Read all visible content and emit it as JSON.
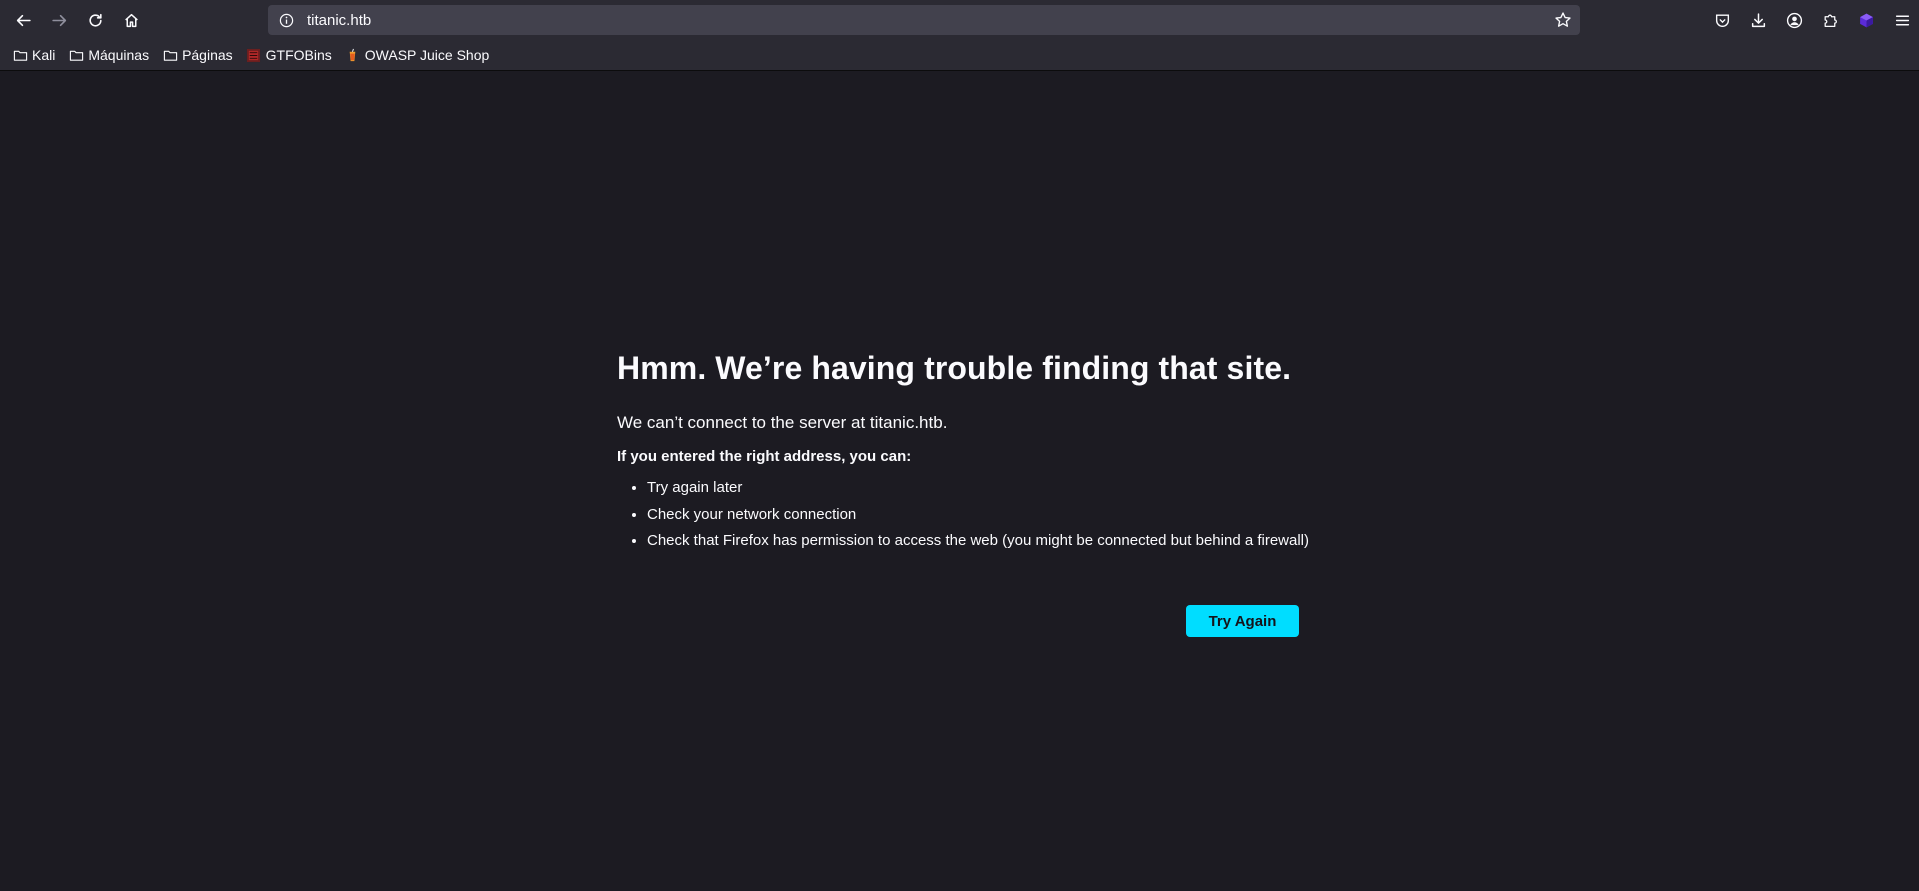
{
  "browser": {
    "url": "titanic.htb",
    "bookmarks": [
      {
        "label": "Kali",
        "icon": "folder-icon"
      },
      {
        "label": "Máquinas",
        "icon": "folder-icon"
      },
      {
        "label": "Páginas",
        "icon": "folder-icon"
      },
      {
        "label": "GTFOBins",
        "icon": "gtfobins-favicon"
      },
      {
        "label": "OWASP Juice Shop",
        "icon": "juice-shop-favicon"
      }
    ]
  },
  "error_page": {
    "title": "Hmm. We’re having trouble finding that site.",
    "description": "We can’t connect to the server at titanic.htb.",
    "hint_heading": "If you entered the right address, you can:",
    "suggestions": [
      "Try again later",
      "Check your network connection",
      "Check that Firefox has permission to access the web (you might be connected but behind a firewall)"
    ],
    "button_label": "Try Again"
  },
  "colors": {
    "page_bg": "#1c1b22",
    "toolbar_bg": "#2b2a33",
    "urlbar_bg": "#42414d",
    "accent": "#00ddff"
  }
}
